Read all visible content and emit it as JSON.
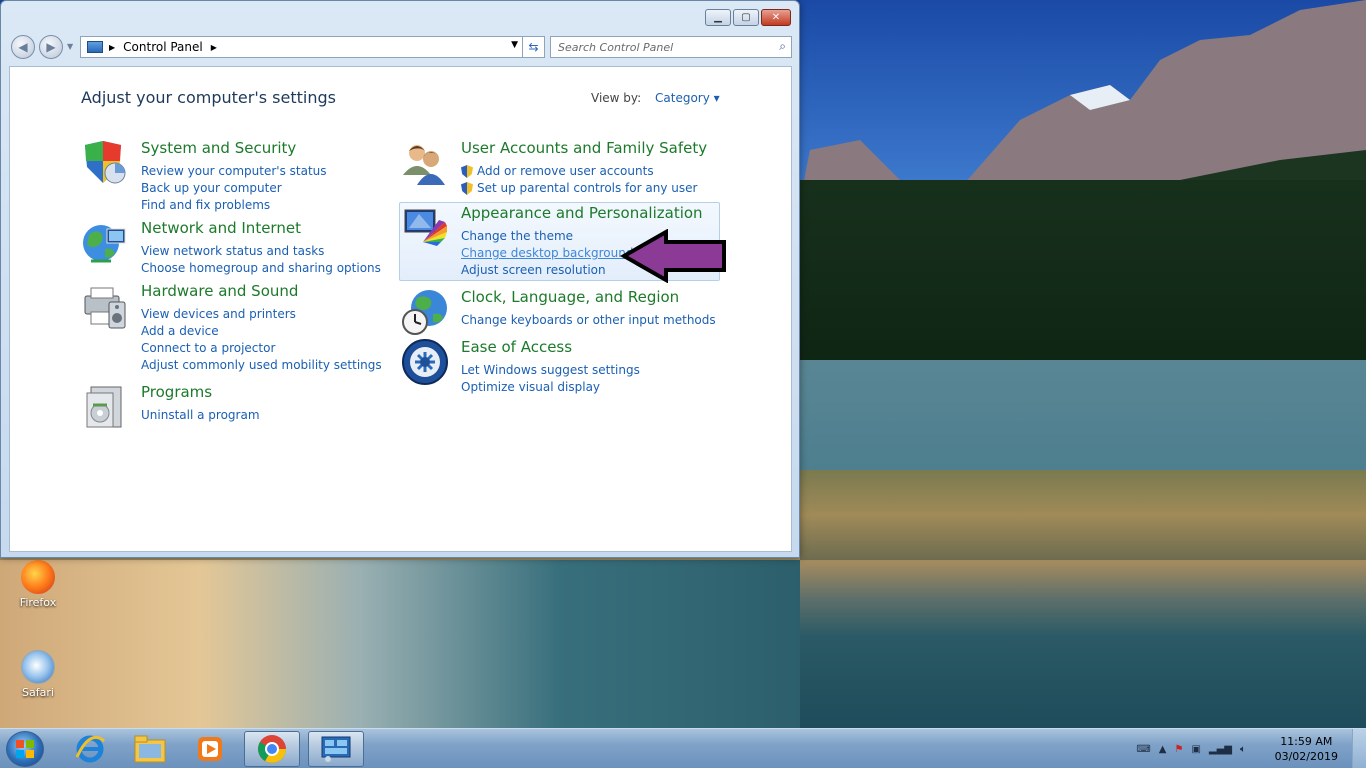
{
  "window": {
    "breadcrumb": "Control Panel",
    "search_placeholder": "Search Control Panel",
    "heading": "Adjust your computer's settings",
    "view_by_label": "View by:",
    "view_by_value": "Category"
  },
  "categories": [
    {
      "title": "System and Security",
      "links": [
        "Review your computer's status",
        "Back up your computer",
        "Find and fix problems"
      ]
    },
    {
      "title": "Network and Internet",
      "links": [
        "View network status and tasks",
        "Choose homegroup and sharing options"
      ]
    },
    {
      "title": "Hardware and Sound",
      "links": [
        "View devices and printers",
        "Add a device",
        "Connect to a projector",
        "Adjust commonly used mobility settings"
      ]
    },
    {
      "title": "Programs",
      "links": [
        "Uninstall a program"
      ]
    },
    {
      "title": "User Accounts and Family Safety",
      "links": [
        "Add or remove user accounts",
        "Set up parental controls for any user"
      ]
    },
    {
      "title": "Appearance and Personalization",
      "links": [
        "Change the theme",
        "Change desktop background",
        "Adjust screen resolution"
      ]
    },
    {
      "title": "Clock, Language, and Region",
      "links": [
        "Change keyboards or other input methods"
      ]
    },
    {
      "title": "Ease of Access",
      "links": [
        "Let Windows suggest settings",
        "Optimize visual display"
      ]
    }
  ],
  "desktop": {
    "icons": [
      "Firefox",
      "Safari"
    ]
  },
  "taskbar": {
    "time": "11:59 AM",
    "date": "03/02/2019"
  },
  "colors": {
    "category_title": "#1c7a2a",
    "link": "#1a5fb4",
    "arrow": "#8b3a96"
  }
}
